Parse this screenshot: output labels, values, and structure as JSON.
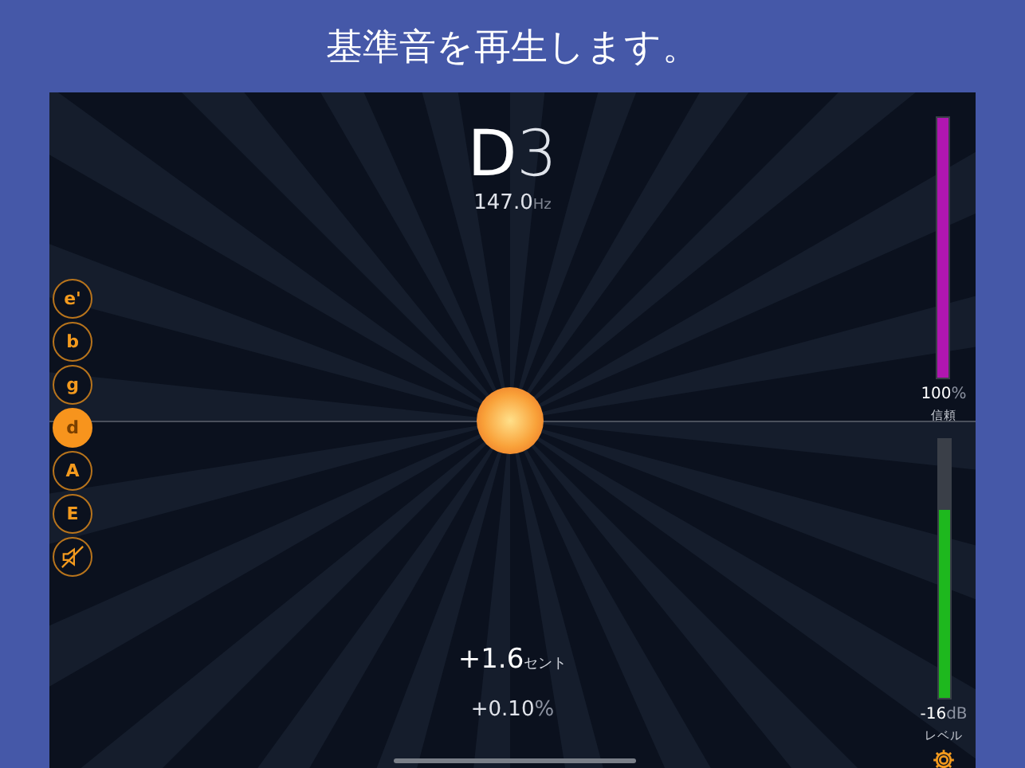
{
  "caption": "基準音を再生します。",
  "note": {
    "name": "D",
    "octave": "3"
  },
  "frequency": {
    "value": "147.0",
    "unit": "Hz"
  },
  "strings": [
    {
      "label": "e'",
      "selected": false
    },
    {
      "label": "b",
      "selected": false
    },
    {
      "label": "g",
      "selected": false
    },
    {
      "label": "d",
      "selected": true
    },
    {
      "label": "A",
      "selected": false
    },
    {
      "label": "E",
      "selected": false
    }
  ],
  "confidence": {
    "level": 1.0,
    "reading": "100",
    "unit": "%",
    "label": "信頼"
  },
  "input_level": {
    "level": 0.73,
    "reading": "-16",
    "unit": "dB",
    "label": "レベル"
  },
  "cents": {
    "value": "+1.6",
    "unit": "セント"
  },
  "deviation": {
    "value": "+0.10",
    "unit": "%"
  }
}
